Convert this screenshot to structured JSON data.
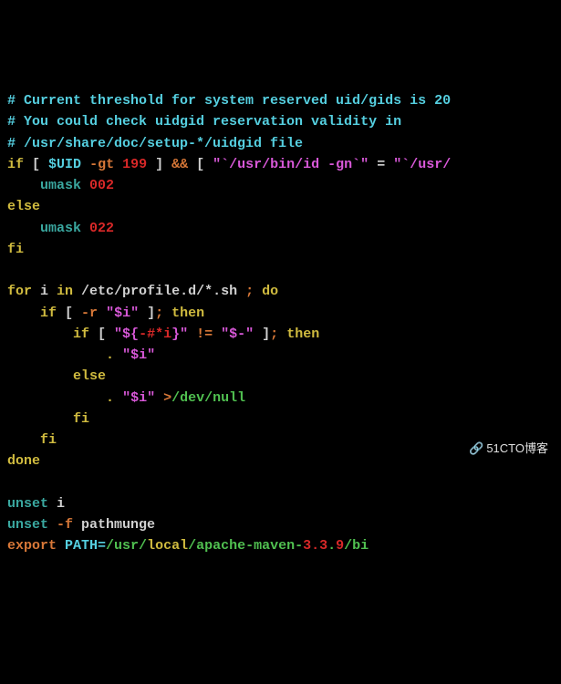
{
  "lines": [
    {
      "type": "comment",
      "segments": [
        {
          "c": "c-comment",
          "t": "# Current threshold for system reserved uid/gids is 20"
        }
      ]
    },
    {
      "type": "comment",
      "segments": [
        {
          "c": "c-comment",
          "t": "# You could check uidgid reservation validity in"
        }
      ]
    },
    {
      "type": "comment",
      "segments": [
        {
          "c": "c-comment",
          "t": "# /usr/share/doc/setup-*/uidgid file"
        }
      ]
    },
    {
      "type": "code",
      "segments": [
        {
          "c": "c-yellow",
          "t": "if"
        },
        {
          "c": "c-white",
          "t": " [ "
        },
        {
          "c": "c-cyan",
          "t": "$UID"
        },
        {
          "c": "c-white",
          "t": " "
        },
        {
          "c": "c-orange",
          "t": "-gt"
        },
        {
          "c": "c-white",
          "t": " "
        },
        {
          "c": "c-red",
          "t": "199"
        },
        {
          "c": "c-white",
          "t": " ] "
        },
        {
          "c": "c-orange",
          "t": "&&"
        },
        {
          "c": "c-white",
          "t": " [ "
        },
        {
          "c": "c-magenta",
          "t": "\"`/usr/bin/id -gn`\""
        },
        {
          "c": "c-white",
          "t": " = "
        },
        {
          "c": "c-magenta",
          "t": "\"`/usr/"
        }
      ]
    },
    {
      "type": "code",
      "segments": [
        {
          "c": "c-white",
          "t": "    "
        },
        {
          "c": "c-teal",
          "t": "umask"
        },
        {
          "c": "c-white",
          "t": " "
        },
        {
          "c": "c-red",
          "t": "002"
        }
      ]
    },
    {
      "type": "code",
      "segments": [
        {
          "c": "c-yellow",
          "t": "else"
        }
      ]
    },
    {
      "type": "code",
      "segments": [
        {
          "c": "c-white",
          "t": "    "
        },
        {
          "c": "c-teal",
          "t": "umask"
        },
        {
          "c": "c-white",
          "t": " "
        },
        {
          "c": "c-red",
          "t": "022"
        }
      ]
    },
    {
      "type": "code",
      "segments": [
        {
          "c": "c-yellow",
          "t": "fi"
        }
      ]
    },
    {
      "type": "blank",
      "segments": [
        {
          "c": "c-white",
          "t": " "
        }
      ]
    },
    {
      "type": "code",
      "segments": [
        {
          "c": "c-yellow",
          "t": "for"
        },
        {
          "c": "c-white",
          "t": " i "
        },
        {
          "c": "c-yellow",
          "t": "in"
        },
        {
          "c": "c-white",
          "t": " /etc/profile.d/*.sh "
        },
        {
          "c": "c-orange",
          "t": ";"
        },
        {
          "c": "c-white",
          "t": " "
        },
        {
          "c": "c-yellow",
          "t": "do"
        }
      ]
    },
    {
      "type": "code",
      "segments": [
        {
          "c": "c-white",
          "t": "    "
        },
        {
          "c": "c-yellow",
          "t": "if"
        },
        {
          "c": "c-white",
          "t": " [ "
        },
        {
          "c": "c-orange",
          "t": "-r"
        },
        {
          "c": "c-white",
          "t": " "
        },
        {
          "c": "c-magenta",
          "t": "\"$i\""
        },
        {
          "c": "c-white",
          "t": " ]"
        },
        {
          "c": "c-orange",
          "t": ";"
        },
        {
          "c": "c-white",
          "t": " "
        },
        {
          "c": "c-yellow",
          "t": "then"
        }
      ]
    },
    {
      "type": "code",
      "segments": [
        {
          "c": "c-white",
          "t": "        "
        },
        {
          "c": "c-yellow",
          "t": "if"
        },
        {
          "c": "c-white",
          "t": " [ "
        },
        {
          "c": "c-magenta",
          "t": "\"${"
        },
        {
          "c": "c-red",
          "t": "-#*i"
        },
        {
          "c": "c-magenta",
          "t": "}\""
        },
        {
          "c": "c-white",
          "t": " "
        },
        {
          "c": "c-orange",
          "t": "!="
        },
        {
          "c": "c-white",
          "t": " "
        },
        {
          "c": "c-magenta",
          "t": "\"$-\""
        },
        {
          "c": "c-white",
          "t": " ]"
        },
        {
          "c": "c-orange",
          "t": ";"
        },
        {
          "c": "c-white",
          "t": " "
        },
        {
          "c": "c-yellow",
          "t": "then"
        }
      ]
    },
    {
      "type": "code",
      "segments": [
        {
          "c": "c-white",
          "t": "            "
        },
        {
          "c": "c-yellow",
          "t": "."
        },
        {
          "c": "c-white",
          "t": " "
        },
        {
          "c": "c-magenta",
          "t": "\"$i\""
        }
      ]
    },
    {
      "type": "code",
      "segments": [
        {
          "c": "c-white",
          "t": "        "
        },
        {
          "c": "c-yellow",
          "t": "else"
        }
      ]
    },
    {
      "type": "code",
      "segments": [
        {
          "c": "c-white",
          "t": "            "
        },
        {
          "c": "c-yellow",
          "t": "."
        },
        {
          "c": "c-white",
          "t": " "
        },
        {
          "c": "c-magenta",
          "t": "\"$i\""
        },
        {
          "c": "c-white",
          "t": " "
        },
        {
          "c": "c-orange",
          "t": ">"
        },
        {
          "c": "c-green",
          "t": "/dev/null"
        }
      ]
    },
    {
      "type": "code",
      "segments": [
        {
          "c": "c-white",
          "t": "        "
        },
        {
          "c": "c-yellow",
          "t": "fi"
        }
      ]
    },
    {
      "type": "code",
      "segments": [
        {
          "c": "c-white",
          "t": "    "
        },
        {
          "c": "c-yellow",
          "t": "fi"
        }
      ]
    },
    {
      "type": "code",
      "segments": [
        {
          "c": "c-yellow",
          "t": "done"
        }
      ]
    },
    {
      "type": "blank",
      "segments": [
        {
          "c": "c-white",
          "t": " "
        }
      ]
    },
    {
      "type": "code",
      "segments": [
        {
          "c": "c-teal",
          "t": "unset"
        },
        {
          "c": "c-white",
          "t": " i"
        }
      ]
    },
    {
      "type": "code",
      "segments": [
        {
          "c": "c-teal",
          "t": "unset"
        },
        {
          "c": "c-white",
          "t": " "
        },
        {
          "c": "c-orange",
          "t": "-f"
        },
        {
          "c": "c-white",
          "t": " pathmunge"
        }
      ]
    },
    {
      "type": "code",
      "segments": [
        {
          "c": "c-orange",
          "t": "export"
        },
        {
          "c": "c-white",
          "t": " "
        },
        {
          "c": "c-cyan",
          "t": "PATH="
        },
        {
          "c": "c-green",
          "t": "/usr/"
        },
        {
          "c": "c-yellow",
          "t": "local"
        },
        {
          "c": "c-green",
          "t": "/apache-maven-"
        },
        {
          "c": "c-red",
          "t": "3.3"
        },
        {
          "c": "c-green",
          "t": "."
        },
        {
          "c": "c-red",
          "t": "9"
        },
        {
          "c": "c-green",
          "t": "/bi"
        }
      ]
    }
  ],
  "watermark": "51CTO博客"
}
